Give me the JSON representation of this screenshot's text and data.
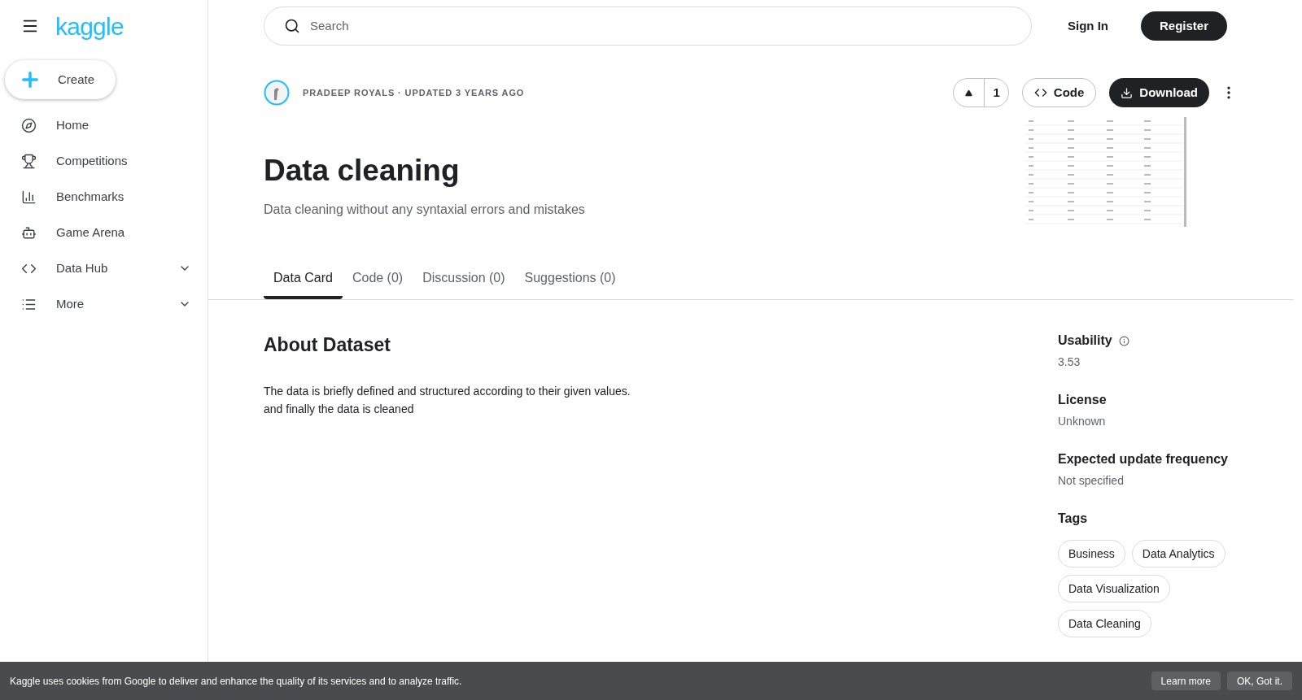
{
  "sidebar": {
    "logo": "kaggle",
    "create": "Create",
    "items": [
      {
        "kind": "home",
        "label": "Home",
        "expandable": false
      },
      {
        "kind": "trophy",
        "label": "Competitions",
        "expandable": false
      },
      {
        "kind": "chart",
        "label": "Benchmarks",
        "expandable": false
      },
      {
        "kind": "robot",
        "label": "Game Arena",
        "expandable": false
      },
      {
        "kind": "code",
        "label": "Data Hub",
        "expandable": true
      },
      {
        "kind": "list",
        "label": "More",
        "expandable": true
      }
    ]
  },
  "header": {
    "search": {
      "placeholder": "Search"
    },
    "sign_in": "Sign In",
    "register": "Register"
  },
  "dataset": {
    "byline": "PRADEEP ROYALS · UPDATED 3 YEARS AGO",
    "votes": "1",
    "code_button": "Code",
    "download_button": "Download",
    "title": "Data cleaning",
    "subtitle": "Data cleaning without any syntaxial errors and mistakes"
  },
  "tabs": [
    {
      "label": "Data Card",
      "selected": true
    },
    {
      "label": "Code (0)",
      "selected": false
    },
    {
      "label": "Discussion (0)",
      "selected": false
    },
    {
      "label": "Suggestions (0)",
      "selected": false
    }
  ],
  "about": {
    "heading": "About Dataset",
    "lines": [
      "The data is briefly defined and structured according to their given values.",
      "and finally the data is cleaned"
    ]
  },
  "meta": [
    {
      "label": "Usability",
      "value": "3.53",
      "info": true
    },
    {
      "label": "License",
      "value": "Unknown",
      "info": false
    },
    {
      "label": "Expected update frequency",
      "value": "Not specified",
      "info": false
    }
  ],
  "tags": {
    "heading": "Tags",
    "items": [
      "Business",
      "Data Analytics",
      "Data Visualization",
      "Data Cleaning"
    ]
  },
  "cookie_banner": {
    "text": "Kaggle uses cookies from Google to deliver and enhance the quality of its services and to analyze traffic.",
    "learn_more": "Learn more",
    "ok": "OK, Got it."
  }
}
